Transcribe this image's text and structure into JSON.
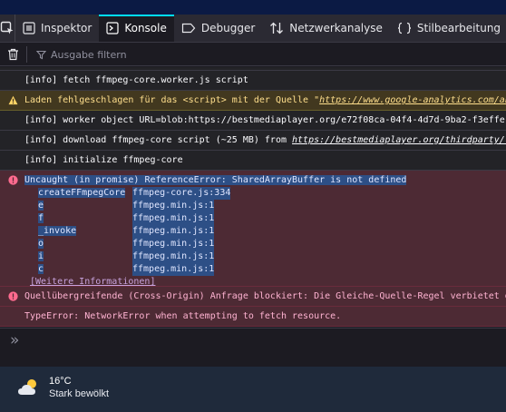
{
  "tabs": [
    {
      "label": "Inspektor",
      "icon": "inspector-icon"
    },
    {
      "label": "Konsole",
      "icon": "console-icon",
      "selected": true
    },
    {
      "label": "Debugger",
      "icon": "debugger-icon"
    },
    {
      "label": "Netzwerkanalyse",
      "icon": "network-icon"
    },
    {
      "label": "Stilbearbeitung",
      "icon": "style-editor-icon"
    }
  ],
  "toolbar": {
    "filter_placeholder": "Ausgabe filtern"
  },
  "console": {
    "rows": {
      "fetch_worker": "[info] fetch ffmpeg-core.worker.js script",
      "warn_prefix": "Laden fehlgeschlagen für das <script> mit der Quelle \"",
      "warn_url": "https://www.google-analytics.com/an",
      "worker_url": "[info] worker object URL=blob:https://bestmediaplayer.org/e72f08ca-04f4-4d7d-9ba2-f3effe",
      "download_prefix": "[info] download ffmpeg-core script (~25 MB) from ",
      "download_url": "https://bestmediaplayer.org/thirdparty/f",
      "init": "[info] initialize ffmpeg-core",
      "error_head": "Uncaught (in promise) ReferenceError: SharedArrayBuffer is not defined",
      "stack": [
        {
          "fn": "createFFmpegCore",
          "loc": "ffmpeg-core.js:334"
        },
        {
          "fn": "e",
          "loc": "ffmpeg.min.js:1"
        },
        {
          "fn": "f",
          "loc": "ffmpeg.min.js:1"
        },
        {
          "fn": "_invoke",
          "loc": "ffmpeg.min.js:1"
        },
        {
          "fn": "o",
          "loc": "ffmpeg.min.js:1"
        },
        {
          "fn": "i",
          "loc": "ffmpeg.min.js:1"
        },
        {
          "fn": "c",
          "loc": "ffmpeg.min.js:1"
        }
      ],
      "more_info": "[Weitere Informationen]",
      "cors": "Quellübergreifende (Cross-Origin) Anfrage blockiert: Die Gleiche-Quelle-Regel verbietet d",
      "type_error": "TypeError: NetworkError when attempting to fetch resource."
    }
  },
  "cmdline": {
    "prompt": "»"
  },
  "weather": {
    "temp": "16°C",
    "condition": "Stark bewölkt",
    "icon": "cloud-sun-icon"
  }
}
